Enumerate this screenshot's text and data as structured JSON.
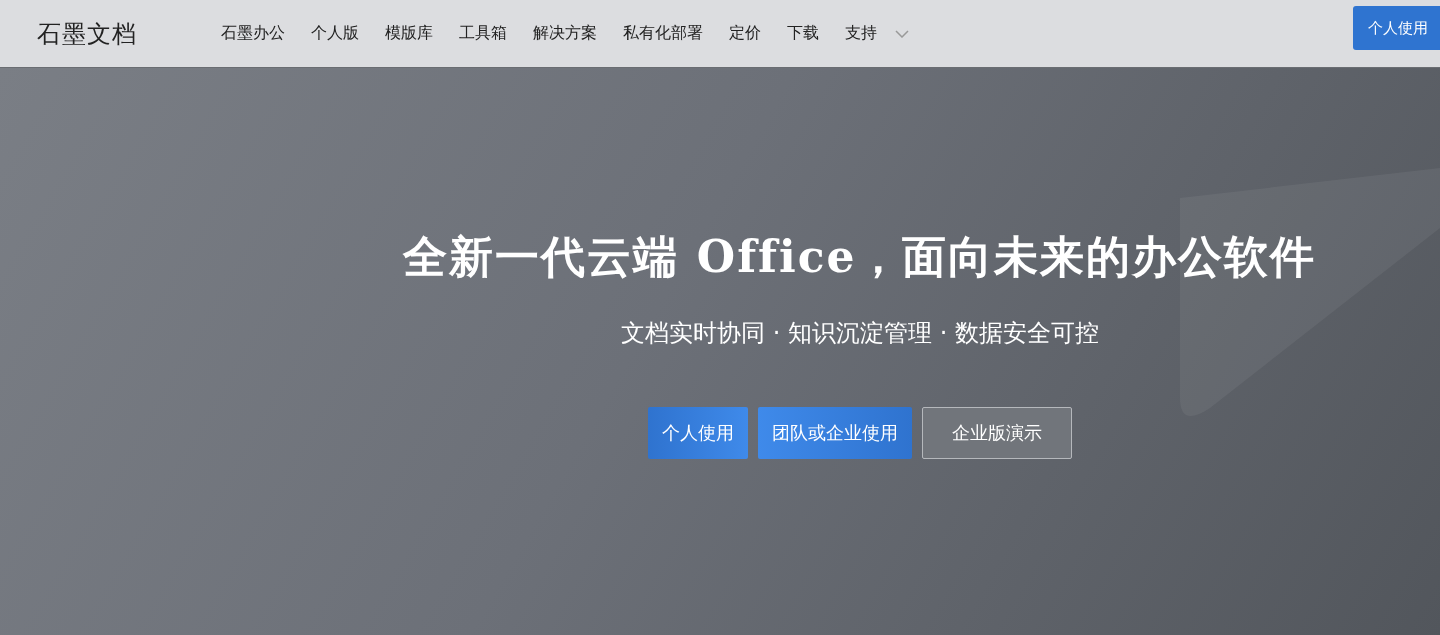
{
  "header": {
    "logo": "石墨文档",
    "nav": [
      {
        "label": "石墨办公",
        "has_menu": false
      },
      {
        "label": "个人版",
        "has_menu": false
      },
      {
        "label": "模版库",
        "has_menu": false
      },
      {
        "label": "工具箱",
        "has_menu": false
      },
      {
        "label": "解决方案",
        "has_menu": false
      },
      {
        "label": "私有化部署",
        "has_menu": false
      },
      {
        "label": "定价",
        "has_menu": false
      },
      {
        "label": "下载",
        "has_menu": false
      },
      {
        "label": "支持",
        "has_menu": true
      }
    ],
    "cta": "个人使用"
  },
  "hero": {
    "title": "全新一代云端 Office，面向未来的办公软件",
    "subtitle": "文档实时协同 · 知识沉淀管理 · 数据安全可控",
    "buttons": [
      {
        "label": "个人使用",
        "kind": "primary"
      },
      {
        "label": "团队或企业使用",
        "kind": "secondary"
      },
      {
        "label": "企业版演示",
        "kind": "outline"
      }
    ]
  }
}
